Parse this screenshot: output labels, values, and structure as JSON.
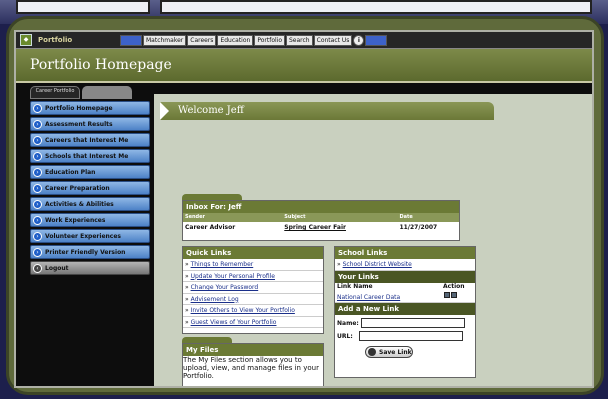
{
  "nav": {
    "brand": "Portfolio",
    "items": [
      "Matchmaker",
      "Careers",
      "Education",
      "Portfolio",
      "Search",
      "Contact Us"
    ]
  },
  "banner": {
    "title": "Portfolio Homepage"
  },
  "sidebar": {
    "tabs": [
      "Career Portfolio",
      ""
    ],
    "items": [
      "Portfolio Homepage",
      "Assessment Results",
      "Careers that Interest Me",
      "Schools that Interest Me",
      "Education Plan",
      "Career Preparation",
      "Activities & Abilities",
      "Work Experiences",
      "Volunteer Experiences",
      "Printer Friendly Version",
      "Logout"
    ]
  },
  "welcome": {
    "text": "Welcome Jeff"
  },
  "inbox": {
    "title": "Inbox For: Jeff",
    "columns": [
      "Sender",
      "Subject",
      "Date"
    ],
    "rows": [
      {
        "sender": "Career Advisor",
        "subject": "Spring Career Fair",
        "date": "11/27/2007"
      }
    ]
  },
  "quick_links": {
    "title": "Quick Links",
    "items": [
      "Things to Remember",
      "Update Your Personal Profile",
      "Change Your Password",
      "Advisement Log",
      "Invite Others to View Your Portfolio",
      "Guest Views of Your Portfolio"
    ]
  },
  "school_links": {
    "title": "School Links",
    "items": [
      "School District Website"
    ]
  },
  "your_links": {
    "title": "Your Links",
    "columns": [
      "Link Name",
      "Action"
    ],
    "rows": [
      {
        "name": "National Career Data"
      }
    ]
  },
  "add_link": {
    "title": "Add a New Link",
    "name_label": "Name:",
    "url_label": "URL:",
    "save_label": "Save Link"
  },
  "my_files": {
    "title": "My Files",
    "description": "The My Files section allows you to upload, view, and manage files in your Portfolio."
  }
}
